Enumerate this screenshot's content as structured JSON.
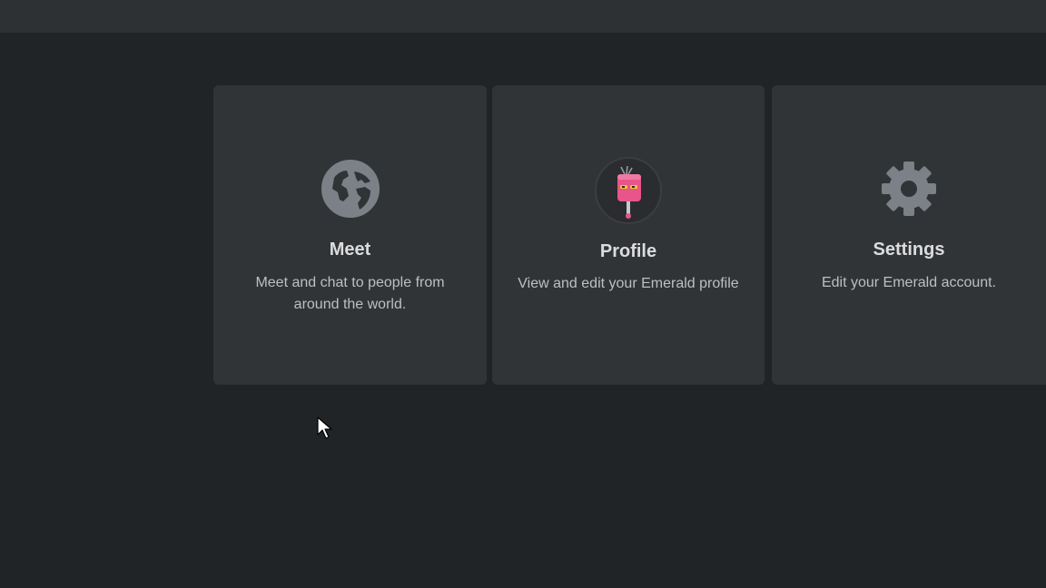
{
  "cards": [
    {
      "title": "Meet",
      "description": "Meet and chat to people from around the world.",
      "icon": "globe-icon"
    },
    {
      "title": "Profile",
      "description": "View and edit your Emerald profile",
      "icon": "profile-avatar"
    },
    {
      "title": "Settings",
      "description": "Edit your Emerald account.",
      "icon": "gear-icon"
    }
  ],
  "colors": {
    "background": "#212426",
    "topbar": "#2e3134",
    "card": "#313437",
    "icon": "#7b8187",
    "title": "#dcdcdc",
    "description": "#bdbfc1",
    "avatar_pink": "#e9558a"
  }
}
